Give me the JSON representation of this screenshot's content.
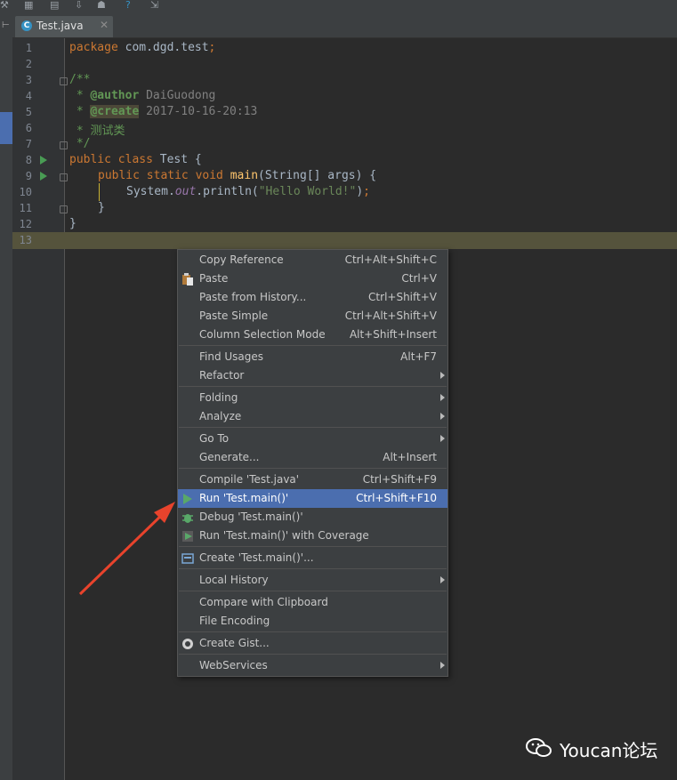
{
  "editor": {
    "tab_name": "Test.java",
    "tab_icon": "class-c-icon",
    "line_numbers": [
      "1",
      "2",
      "3",
      "4",
      "5",
      "6",
      "7",
      "8",
      "9",
      "10",
      "11",
      "12",
      "13"
    ],
    "code": {
      "l1": {
        "kw": "package",
        "rest": " com.dgd.test",
        "semi": ";"
      },
      "l3": "/**",
      "l4": {
        "star": " * ",
        "tag": "@author",
        "val": " DaiGuodong"
      },
      "l5": {
        "star": " * ",
        "tag": "@create",
        "val": " 2017-10-16-20:13"
      },
      "l6": " * 测试类",
      "l7": " */",
      "l8": {
        "kw": "public class",
        "rest": " Test {"
      },
      "l9": {
        "kw": "public static void",
        "fn": " main",
        "rest": "(String[] args) {"
      },
      "l10": {
        "a": "System.",
        "b": "out",
        "c": ".println(",
        "d": "\"Hello World!\"",
        "e": ")",
        "f": ";"
      },
      "l11": "}",
      "l12": "}"
    }
  },
  "context_menu": {
    "items": [
      {
        "label": "Copy Reference",
        "shortcut": "Ctrl+Alt+Shift+C"
      },
      {
        "label": "Paste",
        "shortcut": "Ctrl+V",
        "icon": "paste-icon"
      },
      {
        "label": "Paste from History...",
        "shortcut": "Ctrl+Shift+V"
      },
      {
        "label": "Paste Simple",
        "shortcut": "Ctrl+Alt+Shift+V"
      },
      {
        "label": "Column Selection Mode",
        "shortcut": "Alt+Shift+Insert"
      },
      {
        "label": "Find Usages",
        "shortcut": "Alt+F7"
      },
      {
        "label": "Refactor",
        "submenu": true
      },
      {
        "label": "Folding",
        "submenu": true
      },
      {
        "label": "Analyze",
        "submenu": true
      },
      {
        "label": "Go To",
        "submenu": true
      },
      {
        "label": "Generate...",
        "shortcut": "Alt+Insert"
      },
      {
        "label": "Compile 'Test.java'",
        "shortcut": "Ctrl+Shift+F9"
      },
      {
        "label": "Run 'Test.main()'",
        "shortcut": "Ctrl+Shift+F10",
        "icon": "run-icon",
        "selected": true
      },
      {
        "label": "Debug 'Test.main()'",
        "icon": "debug-icon"
      },
      {
        "label": "Run 'Test.main()' with Coverage",
        "icon": "coverage-icon"
      },
      {
        "label": "Create 'Test.main()'...",
        "icon": "create-config-icon"
      },
      {
        "label": "Local History",
        "submenu": true
      },
      {
        "label": "Compare with Clipboard"
      },
      {
        "label": "File Encoding"
      },
      {
        "label": "Create Gist...",
        "icon": "github-icon"
      },
      {
        "label": "WebServices",
        "submenu": true
      }
    ]
  },
  "watermark": {
    "text": "Youcan论坛",
    "icon": "wechat-icon"
  },
  "colors": {
    "accent": "#4b6eaf",
    "arrow": "#e8432c",
    "editor_bg": "#2b2b2b"
  }
}
